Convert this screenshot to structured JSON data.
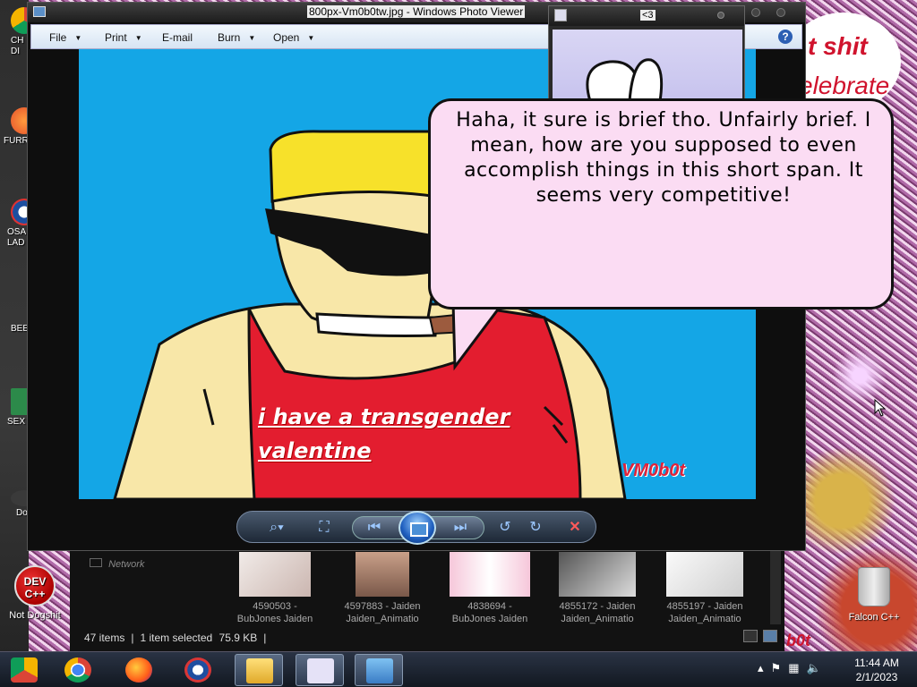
{
  "desktop": {
    "left_icons": [
      "CH\nDI",
      "FURR",
      "OSA\nLAD",
      "BEE",
      "SEX",
      "Do"
    ],
    "dev_icon": {
      "line1": "DEV",
      "line2": "C++",
      "label": "Not Dogshit"
    },
    "recycle_label": "Falcon C++",
    "sign": {
      "line1": "t shit",
      "line2": "elebrate"
    }
  },
  "viewer": {
    "title": "800px-Vm0b0tw.jpg - Windows Photo Viewer",
    "menu": [
      {
        "label": "File",
        "dropdown": true
      },
      {
        "label": "Print",
        "dropdown": true
      },
      {
        "label": "E-mail",
        "dropdown": false
      },
      {
        "label": "Burn",
        "dropdown": true
      },
      {
        "label": "Open",
        "dropdown": true
      }
    ],
    "help_label": "?",
    "image": {
      "caption_line1": "i have a transgender",
      "caption_line2": "valentine",
      "signature": "VM0b0t"
    },
    "controls": {
      "zoom": "zoom-icon",
      "actual_size": "fit-icon",
      "previous": "previous-icon",
      "slideshow": "slideshow-icon",
      "next": "next-icon",
      "rotate_ccw": "rotate-ccw-icon",
      "rotate_cw": "rotate-cw-icon",
      "delete": "delete-icon"
    }
  },
  "chat_window": {
    "title": "<3"
  },
  "speech_bubble": {
    "text": "Haha, it sure is brief tho. Unfairly brief. I mean, how are you supposed to even accomplish things in this short span. It seems very competitive!"
  },
  "explorer": {
    "nav_network": "Network",
    "thumbnails": [
      {
        "line1": "4590503 -",
        "line2": "BubJones Jaiden"
      },
      {
        "line1": "4597883 - Jaiden",
        "line2": "Jaiden_Animatio"
      },
      {
        "line1": "4838694 -",
        "line2": "BubJones Jaiden"
      },
      {
        "line1": "4855172 - Jaiden",
        "line2": "Jaiden_Animatio"
      },
      {
        "line1": "4855197 - Jaiden",
        "line2": "Jaiden_Animatio"
      }
    ],
    "status": {
      "items": "47 items",
      "selected": "1 item selected",
      "size": "75.9 KB"
    },
    "overlay_text": "b0t"
  },
  "taskbar": {
    "clock_time": "11:44 AM",
    "clock_date": "2/1/2023",
    "apps": [
      "chrome-canary",
      "chrome",
      "firefox",
      "obama",
      "file-explorer",
      "bunny-chat",
      "photo-viewer"
    ]
  }
}
